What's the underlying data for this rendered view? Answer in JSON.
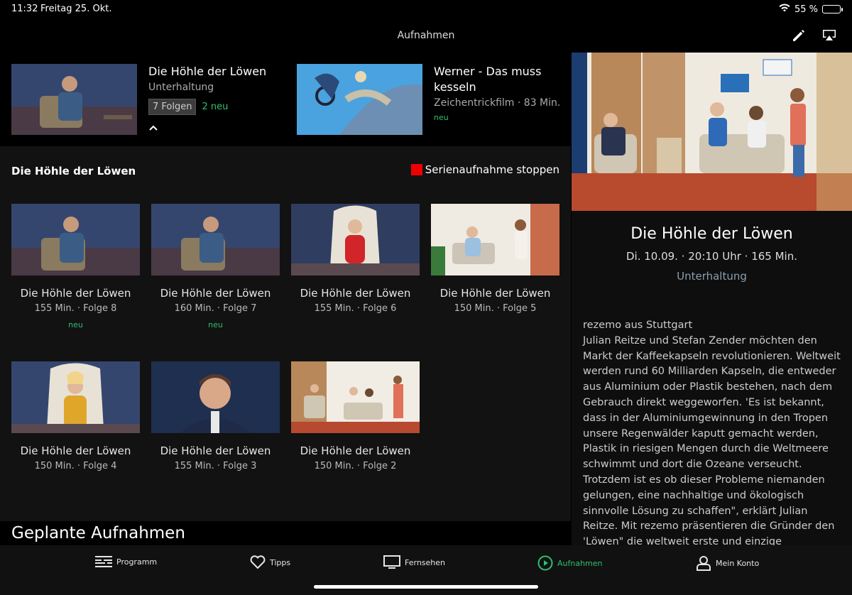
{
  "status": {
    "time": "11:32",
    "date": "Freitag 25. Okt.",
    "battery": "55 %",
    "battery_level": 0.55
  },
  "nav": {
    "title": "Aufnahmen"
  },
  "recordings": [
    {
      "title": "Die Höhle der Löwen",
      "subtitle": "Unterhaltung",
      "episodes_badge": "7 Folgen",
      "new": "2 neu"
    },
    {
      "title": "Werner - Das muss kesseln",
      "subtitle": "Zeichentrickfilm · 83 Min.",
      "new": "neu"
    }
  ],
  "series": {
    "heading": "Die Höhle der Löwen",
    "stop_label": "Serienaufnahme stoppen",
    "episodes": [
      {
        "title": "Die Höhle der Löwen",
        "meta": "155 Min. · Folge 8",
        "new": "neu"
      },
      {
        "title": "Die Höhle der Löwen",
        "meta": "160 Min. · Folge 7",
        "new": "neu"
      },
      {
        "title": "Die Höhle der Löwen",
        "meta": "155 Min. · Folge 6"
      },
      {
        "title": "Die Höhle der Löwen",
        "meta": "150 Min. · Folge 5"
      },
      {
        "title": "Die Höhle der Löwen",
        "meta": "150 Min. · Folge 4"
      },
      {
        "title": "Die Höhle der Löwen",
        "meta": "155 Min. · Folge 3"
      },
      {
        "title": "Die Höhle der Löwen",
        "meta": "150 Min. · Folge 2"
      }
    ]
  },
  "planned": {
    "heading": "Geplante Aufnahmen"
  },
  "detail": {
    "title": "Die Höhle der Löwen",
    "meta": "Di. 10.09. · 20:10 Uhr · 165 Min.",
    "genre": "Unterhaltung",
    "description": "rezemo aus Stuttgart\nJulian Reitze und Stefan Zender möchten den Markt der Kaffeekapseln revolutionieren. Weltweit werden rund 60 Milliarden Kapseln, die entweder aus Aluminium oder Plastik bestehen, nach dem Gebrauch direkt weggeworfen. 'Es ist bekannt, dass in der Aluminiumgewinnung in den Tropen unsere Regenwälder kaputt gemacht werden, Plastik in riesigen Mengen durch die Weltmeere schwimmt und dort die Ozeane verseucht. Trotzdem ist es ob dieser Probleme niemanden gelungen, eine nachhaltige und ökologisch sinnvolle Lösung zu schaffen\", erklärt Julian Reitze. Mit rezemo präsentieren die Gründer den 'Löwen\" die weltweit erste und einzige Kaffeekapsel aus"
  },
  "tabs": [
    {
      "label": "Programm",
      "icon": "program-guide-icon"
    },
    {
      "label": "Tipps",
      "icon": "heart-icon"
    },
    {
      "label": "Fernsehen",
      "icon": "tv-icon"
    },
    {
      "label": "Aufnahmen",
      "icon": "play-circle-icon",
      "active": true
    },
    {
      "label": "Mein Konto",
      "icon": "user-icon"
    }
  ],
  "colors": {
    "accent": "#2fbf71",
    "stop": "#e00000",
    "genre": "#8a9fb0"
  }
}
